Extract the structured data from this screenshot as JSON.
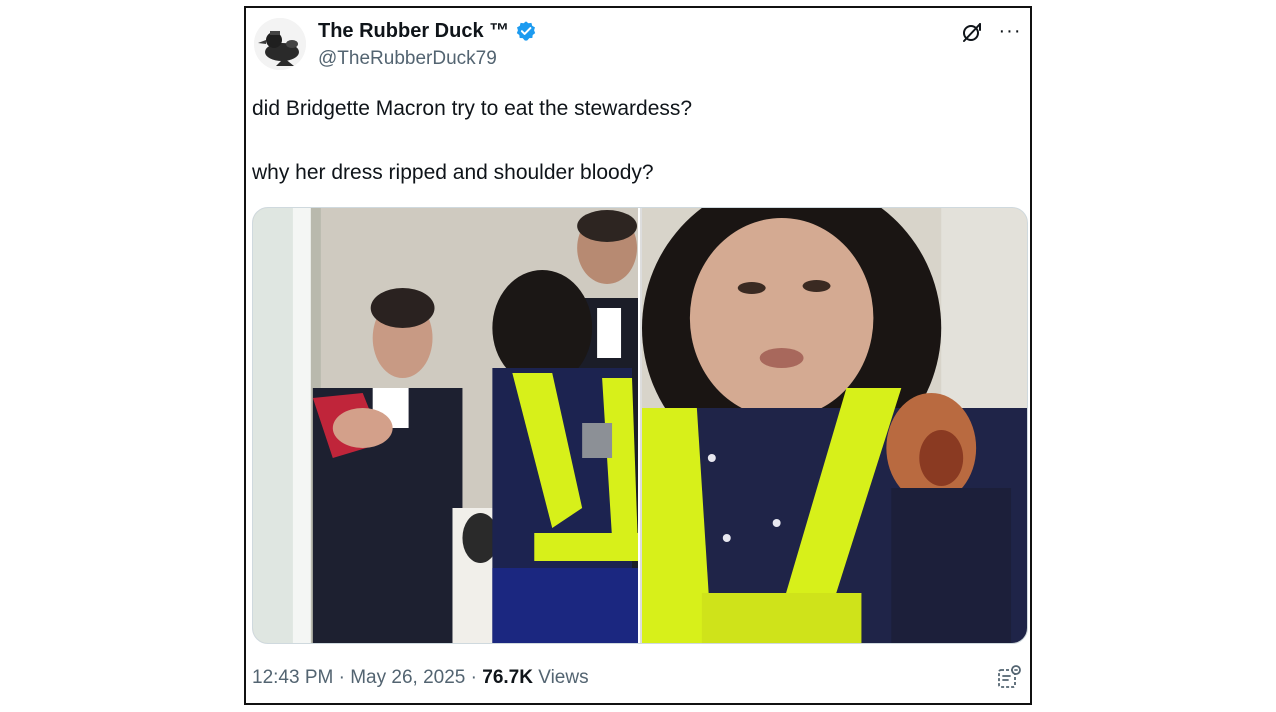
{
  "tweet": {
    "author": {
      "display_name": "The Rubber Duck ™",
      "handle": "@TheRubberDuck79",
      "verified": true,
      "verified_color": "#1d9bf0"
    },
    "text_lines": [
      "did Bridgette Macron try to eat the stewardess?",
      "why her dress ripped and shoulder bloody?"
    ],
    "media": {
      "count": 2,
      "items": [
        "photo-left",
        "photo-right"
      ]
    },
    "meta": {
      "time": "12:43 PM",
      "separator": "·",
      "date": "May 26, 2025",
      "views_count": "76.7K",
      "views_label": "Views"
    },
    "icons": {
      "grok": "grok-icon",
      "more": "more-icon",
      "analytics": "analytics-icon"
    },
    "colors": {
      "text": "#0f1419",
      "secondary": "#536471",
      "vest": "#d7f01a"
    }
  }
}
